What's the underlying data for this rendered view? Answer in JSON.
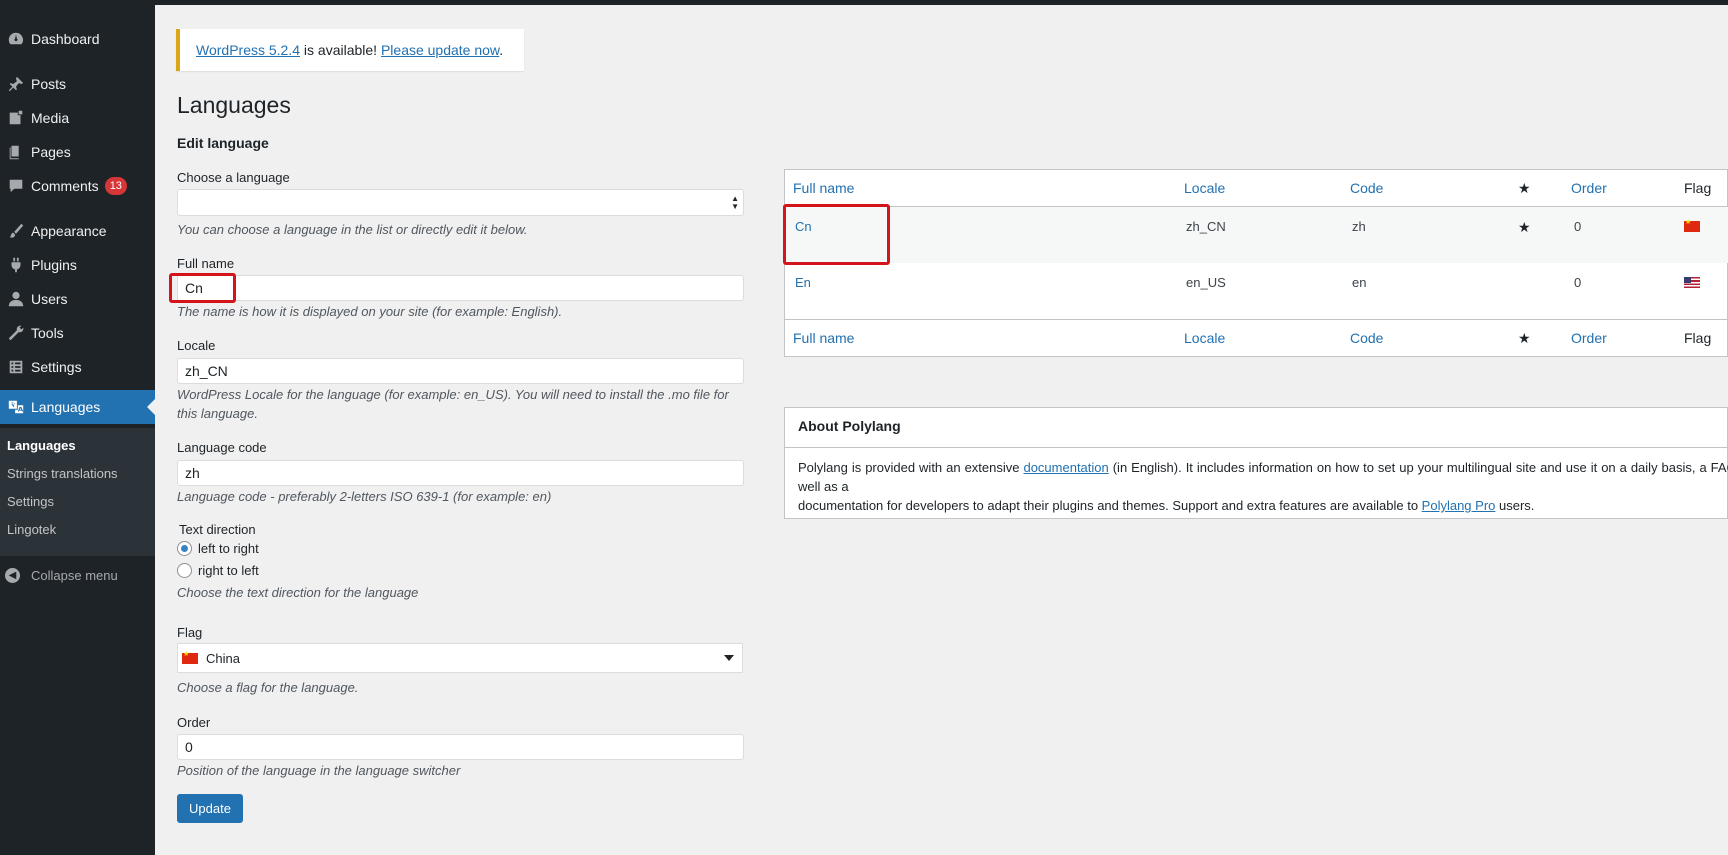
{
  "sidebar": {
    "items": [
      {
        "label": "Dashboard",
        "icon": "dashboard-icon"
      },
      {
        "label": "Posts",
        "icon": "pin-icon"
      },
      {
        "label": "Media",
        "icon": "media-icon"
      },
      {
        "label": "Pages",
        "icon": "pages-icon"
      },
      {
        "label": "Comments",
        "icon": "comments-icon",
        "badge": "13"
      },
      {
        "label": "Appearance",
        "icon": "brush-icon"
      },
      {
        "label": "Plugins",
        "icon": "plug-icon"
      },
      {
        "label": "Users",
        "icon": "user-icon"
      },
      {
        "label": "Tools",
        "icon": "wrench-icon"
      },
      {
        "label": "Settings",
        "icon": "settings-icon"
      },
      {
        "label": "Languages",
        "icon": "translation-icon",
        "current": true
      }
    ],
    "submenu": [
      "Languages",
      "Strings translations",
      "Settings",
      "Lingotek"
    ],
    "collapse": "Collapse menu"
  },
  "notice": {
    "link1": "WordPress 5.2.4",
    "middle": " is available! ",
    "link2": "Please update now",
    "end": "."
  },
  "page": {
    "title": "Languages",
    "section": "Edit language"
  },
  "form": {
    "choose_label": "Choose a language",
    "choose_desc": "You can choose a language in the list or directly edit it below.",
    "fullname_label": "Full name",
    "fullname_value": "Cn",
    "fullname_desc": "The name is how it is displayed on your site (for example: English).",
    "locale_label": "Locale",
    "locale_value": "zh_CN",
    "locale_desc_1": "WordPress Locale for the language (for example: en_US). You will need to install the .mo file for",
    "locale_desc_2": "this language.",
    "code_label": "Language code",
    "code_value": "zh",
    "code_desc": "Language code - preferably 2-letters ISO 639-1 (for example: en)",
    "direction_label": "Text direction",
    "direction_ltr": "left to right",
    "direction_rtl": "right to left",
    "direction_desc": "Choose the text direction for the language",
    "flag_label": "Flag",
    "flag_value": "China",
    "flag_desc": "Choose a flag for the language.",
    "order_label": "Order",
    "order_value": "0",
    "order_desc": "Position of the language in the language switcher",
    "submit": "Update"
  },
  "table": {
    "headers": [
      "Full name",
      "Locale",
      "Code",
      "★",
      "Order",
      "Flag"
    ],
    "rows": [
      {
        "name": "Cn",
        "locale": "zh_CN",
        "code": "zh",
        "default": "★",
        "order": "0",
        "flag": "cn-flag-icon"
      },
      {
        "name": "En",
        "locale": "en_US",
        "code": "en",
        "default": "",
        "order": "0",
        "flag": "us-flag-icon"
      }
    ]
  },
  "about": {
    "title": "About Polylang",
    "t1": "Polylang is provided with an extensive ",
    "doc_link": "documentation",
    "t2": " (in English). It includes information on how to set up your multilingual site and use it on a daily basis, a FAQ, as well as a",
    "t3": "documentation for developers to adapt their plugins and themes. Support and extra features are available to ",
    "pro_link": "Polylang Pro",
    "t4": " users."
  }
}
